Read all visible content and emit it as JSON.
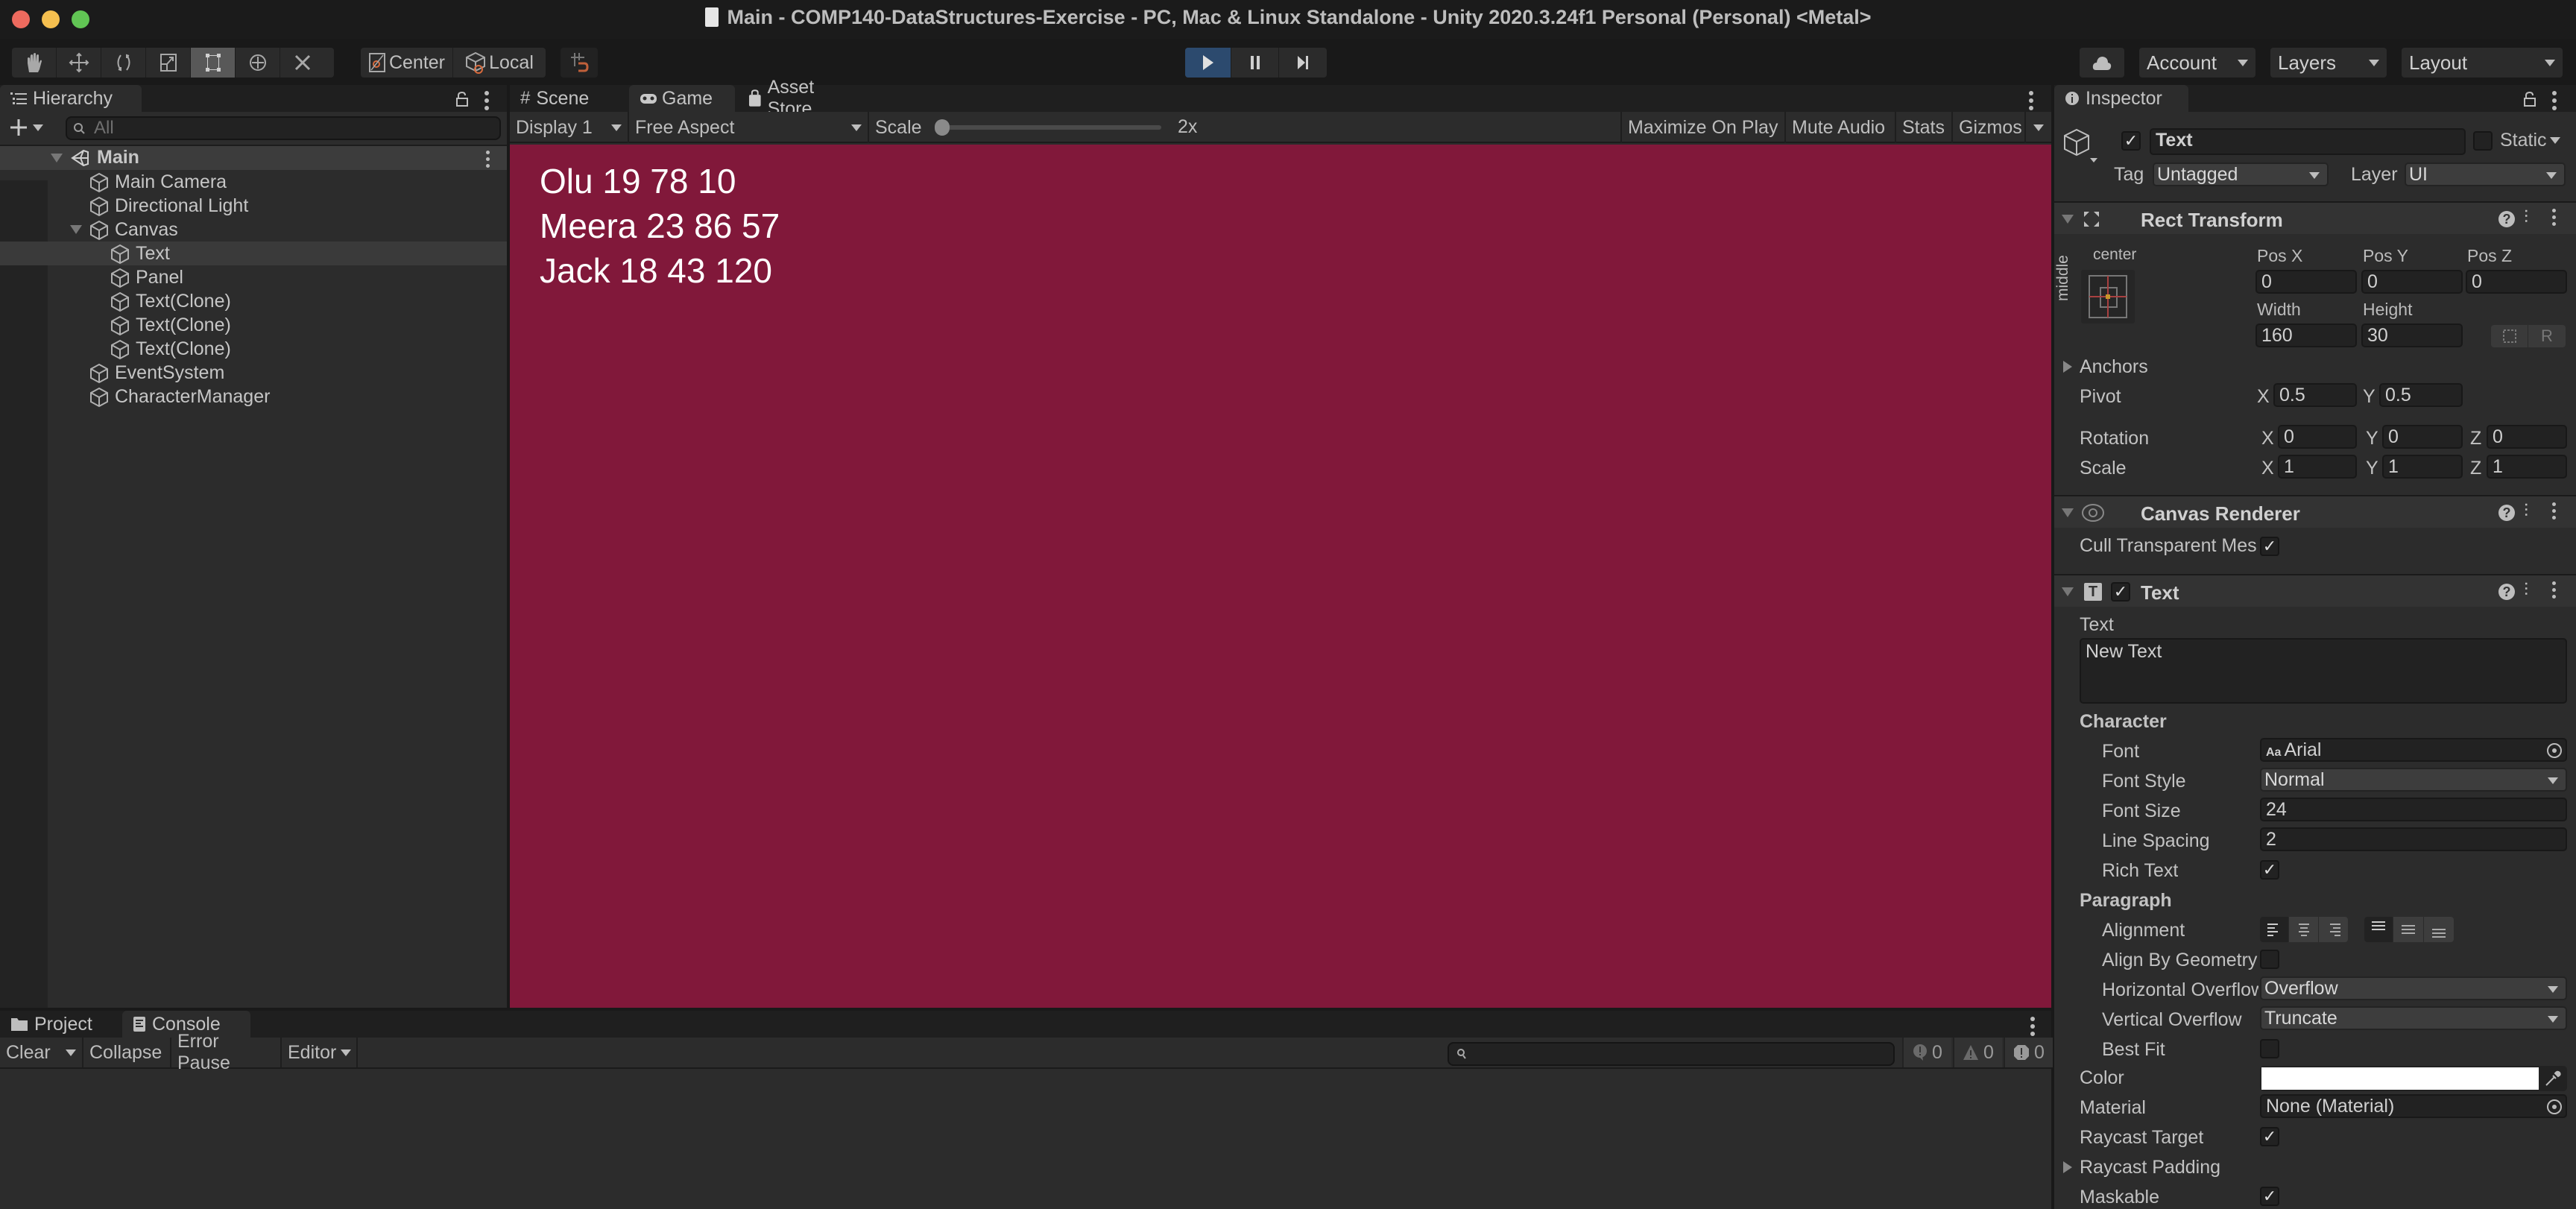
{
  "window": {
    "title": "Main - COMP140-DataStructures-Exercise - PC, Mac & Linux Standalone - Unity 2020.3.24f1 Personal (Personal) <Metal>",
    "traffic_lights": {
      "close": "#ed6a5e",
      "minimize": "#f5bf4f",
      "maximize": "#61c554"
    }
  },
  "toolbar": {
    "tools": [
      {
        "name": "hand-tool",
        "icon": "hand-icon"
      },
      {
        "name": "move-tool",
        "icon": "move-icon"
      },
      {
        "name": "rotate-tool",
        "icon": "rotate-icon"
      },
      {
        "name": "scale-tool",
        "icon": "scale-icon"
      },
      {
        "name": "rect-tool",
        "icon": "rect-icon",
        "active": true
      },
      {
        "name": "transform-tool",
        "icon": "transform-icon"
      },
      {
        "name": "custom-tool",
        "icon": "tools-icon"
      }
    ],
    "pivot_mode": "Center",
    "pivot_rotation": "Local",
    "play_controls": {
      "play": "play",
      "pause": "pause",
      "step": "step"
    },
    "account_label": "Account",
    "layers_label": "Layers",
    "layout_label": "Layout"
  },
  "hierarchy": {
    "tab_label": "Hierarchy",
    "search_placeholder": "All",
    "scene_name": "Main",
    "items": [
      {
        "label": "Main Camera",
        "depth": 1
      },
      {
        "label": "Directional Light",
        "depth": 1
      },
      {
        "label": "Canvas",
        "depth": 1,
        "expanded": true
      },
      {
        "label": "Text",
        "depth": 2,
        "selected": true
      },
      {
        "label": "Panel",
        "depth": 2
      },
      {
        "label": "Text(Clone)",
        "depth": 2
      },
      {
        "label": "Text(Clone)",
        "depth": 2
      },
      {
        "label": "Text(Clone)",
        "depth": 2
      },
      {
        "label": "EventSystem",
        "depth": 1
      },
      {
        "label": "CharacterManager",
        "depth": 1
      }
    ]
  },
  "center_panel": {
    "tabs": [
      {
        "label": "Scene",
        "icon": "grid-icon"
      },
      {
        "label": "Game",
        "icon": "gamepad-icon",
        "active": true
      },
      {
        "label": "Asset Store",
        "icon": "bag-icon"
      }
    ],
    "game_toolbar": {
      "display": "Display 1",
      "aspect": "Free Aspect",
      "scale_label": "Scale",
      "scale_value": "2x",
      "scale_slider_fraction": 0,
      "maximize_on_play": "Maximize On Play",
      "mute_audio": "Mute Audio",
      "stats": "Stats",
      "gizmos": "Gizmos"
    },
    "game_view": {
      "background": "#81183a",
      "lines": [
        "Olu 19 78 10",
        "Meera 23 86 57",
        "Jack 18 43 120"
      ]
    }
  },
  "console": {
    "tabs": [
      {
        "label": "Project",
        "icon": "folder-icon"
      },
      {
        "label": "Console",
        "icon": "console-icon",
        "active": true
      }
    ],
    "toolbar": {
      "clear": "Clear",
      "collapse": "Collapse",
      "error_pause": "Error Pause",
      "editor": "Editor"
    },
    "search_placeholder": "",
    "counts": {
      "info": "0",
      "warning": "0",
      "error": "0"
    }
  },
  "inspector": {
    "tab_label": "Inspector",
    "object": {
      "active": true,
      "name": "Text",
      "static_label": "Static",
      "static": false,
      "tag_label": "Tag",
      "tag": "Untagged",
      "layer_label": "Layer",
      "layer": "UI"
    },
    "rect_transform": {
      "title": "Rect Transform",
      "anchor_h": "center",
      "anchor_v": "middle",
      "pos_x_label": "Pos X",
      "pos_x": "0",
      "pos_y_label": "Pos Y",
      "pos_y": "0",
      "pos_z_label": "Pos Z",
      "pos_z": "0",
      "width_label": "Width",
      "width": "160",
      "height_label": "Height",
      "height": "30",
      "blueprint_btn": "",
      "raw_btn": "R",
      "anchors_label": "Anchors",
      "pivot_label": "Pivot",
      "pivot_x": "0.5",
      "pivot_y": "0.5",
      "rotation_label": "Rotation",
      "rot_x": "0",
      "rot_y": "0",
      "rot_z": "0",
      "scale_label": "Scale",
      "scale_x": "1",
      "scale_y": "1",
      "scale_z": "1",
      "x": "X",
      "y": "Y",
      "z": "Z"
    },
    "canvas_renderer": {
      "title": "Canvas Renderer",
      "cull_label": "Cull Transparent Mes",
      "cull": true
    },
    "text_component": {
      "title": "Text",
      "enabled": true,
      "text_label": "Text",
      "text_value": "New Text",
      "character_label": "Character",
      "font_label": "Font",
      "font": "Arial",
      "font_style_label": "Font Style",
      "font_style": "Normal",
      "font_size_label": "Font Size",
      "font_size": "24",
      "line_spacing_label": "Line Spacing",
      "line_spacing": "2",
      "rich_text_label": "Rich Text",
      "rich_text": true,
      "paragraph_label": "Paragraph",
      "alignment_label": "Alignment",
      "align_by_geometry_label": "Align By Geometry",
      "align_by_geometry": false,
      "h_overflow_label": "Horizontal Overflow",
      "h_overflow": "Overflow",
      "v_overflow_label": "Vertical Overflow",
      "v_overflow": "Truncate",
      "best_fit_label": "Best Fit",
      "best_fit": false,
      "color_label": "Color",
      "color": "#ffffff",
      "material_label": "Material",
      "material": "None (Material)",
      "raycast_target_label": "Raycast Target",
      "raycast_target": true,
      "raycast_padding_label": "Raycast Padding",
      "maskable_label": "Maskable",
      "maskable": true
    }
  }
}
